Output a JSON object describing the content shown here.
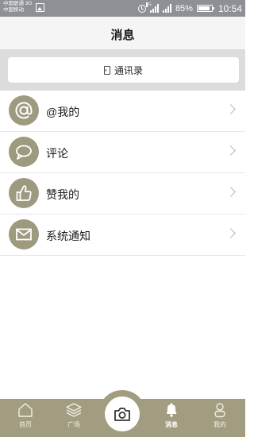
{
  "status_bar": {
    "carrier_1": "中国联通 3G",
    "carrier_2": "中国移动",
    "signal_label": "4G",
    "battery": "85%",
    "battery_level": 0.85,
    "time": "10:54"
  },
  "header": {
    "title": "消息"
  },
  "contacts": {
    "label": "通讯录",
    "icon": "address-book-icon"
  },
  "list": [
    {
      "label": "@我的",
      "icon": "at-icon"
    },
    {
      "label": "评论",
      "icon": "speech-bubble-icon"
    },
    {
      "label": "赞我的",
      "icon": "thumbs-up-icon"
    },
    {
      "label": "系统通知",
      "icon": "envelope-icon"
    }
  ],
  "bottom_nav": {
    "tabs": [
      {
        "label": "首页",
        "icon": "home-icon"
      },
      {
        "label": "广场",
        "icon": "layers-icon"
      },
      {
        "label": "消息",
        "icon": "bell-icon",
        "active": true
      },
      {
        "label": "我的",
        "icon": "person-icon"
      }
    ],
    "center": {
      "icon": "camera-icon"
    }
  },
  "colors": {
    "accent": "#9e9a7f",
    "nav_bg": "#a29d80",
    "status_bar": "#8f9095"
  }
}
